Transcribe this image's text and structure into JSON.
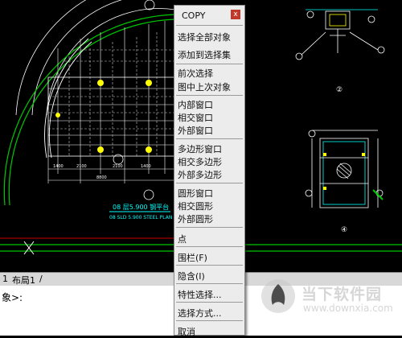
{
  "drawing": {
    "plan_title": "08 层5.900 钢平台",
    "plan_subtitle": "08 SLD 5.900 STEEL PLAN",
    "detail_label_top": "②",
    "detail_label_bottom": "④"
  },
  "context_menu": {
    "title": "COPY",
    "close_glyph": "x",
    "items": [
      "选择全部对象",
      "添加到选择集",
      "前次选择",
      "图中上次对象",
      "内部窗口",
      "相交窗口",
      "外部窗口",
      "多边形窗口",
      "相交多边形",
      "外部多边形",
      "圆形窗口",
      "相交圆形",
      "外部圆形",
      "点",
      "围栏(F)",
      "隐含(I)",
      "特性选择...",
      "选择方式...",
      "取消"
    ]
  },
  "layout_tabs": {
    "tab_label": "布局1"
  },
  "command_line": {
    "prompt": "象>:"
  },
  "watermark": {
    "name": "当下软件园",
    "url": "www.downxia.com"
  },
  "colors": {
    "background": "#000000",
    "drawing_lines": "#ffffff",
    "grid_dashed": "#c8c8c8",
    "arc_green": "#00c800",
    "column_marks": "#ffff00",
    "dimension_cyan": "#00ffff",
    "section_frame": "#6a6a6a",
    "close_button": "#c0392b"
  }
}
